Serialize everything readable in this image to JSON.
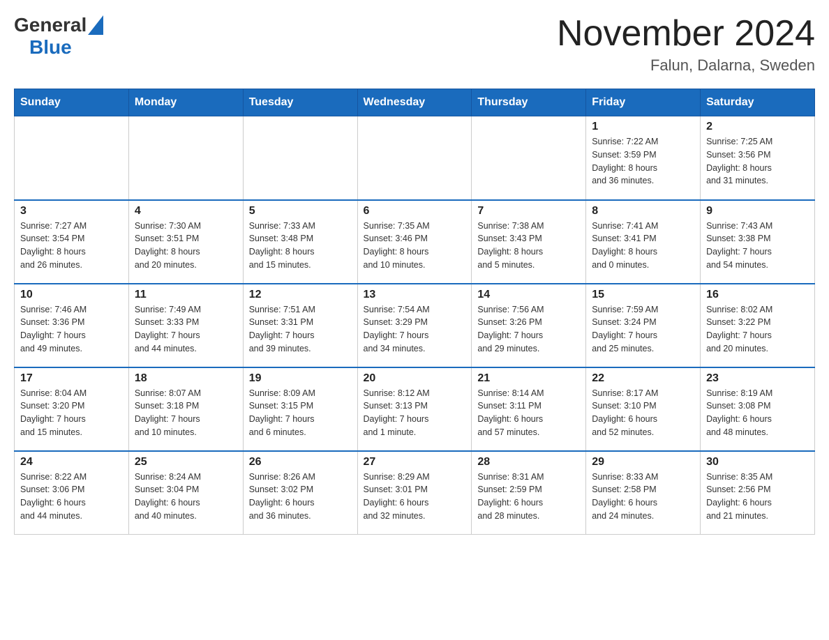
{
  "header": {
    "logo": {
      "text_general": "General",
      "text_blue": "Blue"
    },
    "title": "November 2024",
    "location": "Falun, Dalarna, Sweden"
  },
  "calendar": {
    "days_of_week": [
      "Sunday",
      "Monday",
      "Tuesday",
      "Wednesday",
      "Thursday",
      "Friday",
      "Saturday"
    ],
    "weeks": [
      [
        {
          "day": "",
          "info": ""
        },
        {
          "day": "",
          "info": ""
        },
        {
          "day": "",
          "info": ""
        },
        {
          "day": "",
          "info": ""
        },
        {
          "day": "",
          "info": ""
        },
        {
          "day": "1",
          "info": "Sunrise: 7:22 AM\nSunset: 3:59 PM\nDaylight: 8 hours\nand 36 minutes."
        },
        {
          "day": "2",
          "info": "Sunrise: 7:25 AM\nSunset: 3:56 PM\nDaylight: 8 hours\nand 31 minutes."
        }
      ],
      [
        {
          "day": "3",
          "info": "Sunrise: 7:27 AM\nSunset: 3:54 PM\nDaylight: 8 hours\nand 26 minutes."
        },
        {
          "day": "4",
          "info": "Sunrise: 7:30 AM\nSunset: 3:51 PM\nDaylight: 8 hours\nand 20 minutes."
        },
        {
          "day": "5",
          "info": "Sunrise: 7:33 AM\nSunset: 3:48 PM\nDaylight: 8 hours\nand 15 minutes."
        },
        {
          "day": "6",
          "info": "Sunrise: 7:35 AM\nSunset: 3:46 PM\nDaylight: 8 hours\nand 10 minutes."
        },
        {
          "day": "7",
          "info": "Sunrise: 7:38 AM\nSunset: 3:43 PM\nDaylight: 8 hours\nand 5 minutes."
        },
        {
          "day": "8",
          "info": "Sunrise: 7:41 AM\nSunset: 3:41 PM\nDaylight: 8 hours\nand 0 minutes."
        },
        {
          "day": "9",
          "info": "Sunrise: 7:43 AM\nSunset: 3:38 PM\nDaylight: 7 hours\nand 54 minutes."
        }
      ],
      [
        {
          "day": "10",
          "info": "Sunrise: 7:46 AM\nSunset: 3:36 PM\nDaylight: 7 hours\nand 49 minutes."
        },
        {
          "day": "11",
          "info": "Sunrise: 7:49 AM\nSunset: 3:33 PM\nDaylight: 7 hours\nand 44 minutes."
        },
        {
          "day": "12",
          "info": "Sunrise: 7:51 AM\nSunset: 3:31 PM\nDaylight: 7 hours\nand 39 minutes."
        },
        {
          "day": "13",
          "info": "Sunrise: 7:54 AM\nSunset: 3:29 PM\nDaylight: 7 hours\nand 34 minutes."
        },
        {
          "day": "14",
          "info": "Sunrise: 7:56 AM\nSunset: 3:26 PM\nDaylight: 7 hours\nand 29 minutes."
        },
        {
          "day": "15",
          "info": "Sunrise: 7:59 AM\nSunset: 3:24 PM\nDaylight: 7 hours\nand 25 minutes."
        },
        {
          "day": "16",
          "info": "Sunrise: 8:02 AM\nSunset: 3:22 PM\nDaylight: 7 hours\nand 20 minutes."
        }
      ],
      [
        {
          "day": "17",
          "info": "Sunrise: 8:04 AM\nSunset: 3:20 PM\nDaylight: 7 hours\nand 15 minutes."
        },
        {
          "day": "18",
          "info": "Sunrise: 8:07 AM\nSunset: 3:18 PM\nDaylight: 7 hours\nand 10 minutes."
        },
        {
          "day": "19",
          "info": "Sunrise: 8:09 AM\nSunset: 3:15 PM\nDaylight: 7 hours\nand 6 minutes."
        },
        {
          "day": "20",
          "info": "Sunrise: 8:12 AM\nSunset: 3:13 PM\nDaylight: 7 hours\nand 1 minute."
        },
        {
          "day": "21",
          "info": "Sunrise: 8:14 AM\nSunset: 3:11 PM\nDaylight: 6 hours\nand 57 minutes."
        },
        {
          "day": "22",
          "info": "Sunrise: 8:17 AM\nSunset: 3:10 PM\nDaylight: 6 hours\nand 52 minutes."
        },
        {
          "day": "23",
          "info": "Sunrise: 8:19 AM\nSunset: 3:08 PM\nDaylight: 6 hours\nand 48 minutes."
        }
      ],
      [
        {
          "day": "24",
          "info": "Sunrise: 8:22 AM\nSunset: 3:06 PM\nDaylight: 6 hours\nand 44 minutes."
        },
        {
          "day": "25",
          "info": "Sunrise: 8:24 AM\nSunset: 3:04 PM\nDaylight: 6 hours\nand 40 minutes."
        },
        {
          "day": "26",
          "info": "Sunrise: 8:26 AM\nSunset: 3:02 PM\nDaylight: 6 hours\nand 36 minutes."
        },
        {
          "day": "27",
          "info": "Sunrise: 8:29 AM\nSunset: 3:01 PM\nDaylight: 6 hours\nand 32 minutes."
        },
        {
          "day": "28",
          "info": "Sunrise: 8:31 AM\nSunset: 2:59 PM\nDaylight: 6 hours\nand 28 minutes."
        },
        {
          "day": "29",
          "info": "Sunrise: 8:33 AM\nSunset: 2:58 PM\nDaylight: 6 hours\nand 24 minutes."
        },
        {
          "day": "30",
          "info": "Sunrise: 8:35 AM\nSunset: 2:56 PM\nDaylight: 6 hours\nand 21 minutes."
        }
      ]
    ]
  }
}
